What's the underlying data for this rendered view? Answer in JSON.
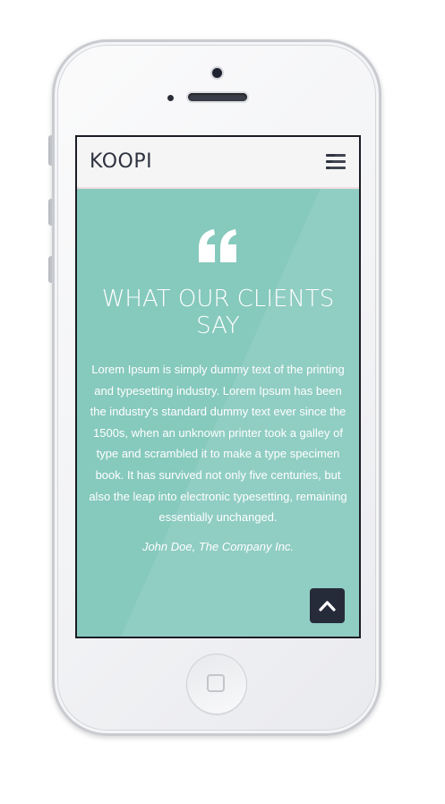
{
  "header": {
    "logo_text": "KOOPI",
    "menu_icon": "hamburger-menu-icon"
  },
  "testimonial": {
    "quote_icon": "quote-icon",
    "heading_line1": "WHAT OUR CLIENTS",
    "heading_line2": "SAY",
    "text": "Lorem Ipsum is simply dummy text of the printing and typesetting industry. Lorem Ipsum has been the industry's standard dummy text ever since the 1500s, when an unknown printer took a galley of type and scrambled it to make a type specimen book. It has survived not only five centuries, but also the leap into electronic typesetting, remaining essentially unchanged.",
    "author": "John Doe, The Company Inc."
  },
  "scroll_top": {
    "icon": "chevron-up-icon"
  },
  "colors": {
    "content_bg": "#86c9bd",
    "navbar_bg": "#f6f5f5",
    "dark_accent": "#262b3a",
    "text_on_teal": "#ffffff"
  }
}
